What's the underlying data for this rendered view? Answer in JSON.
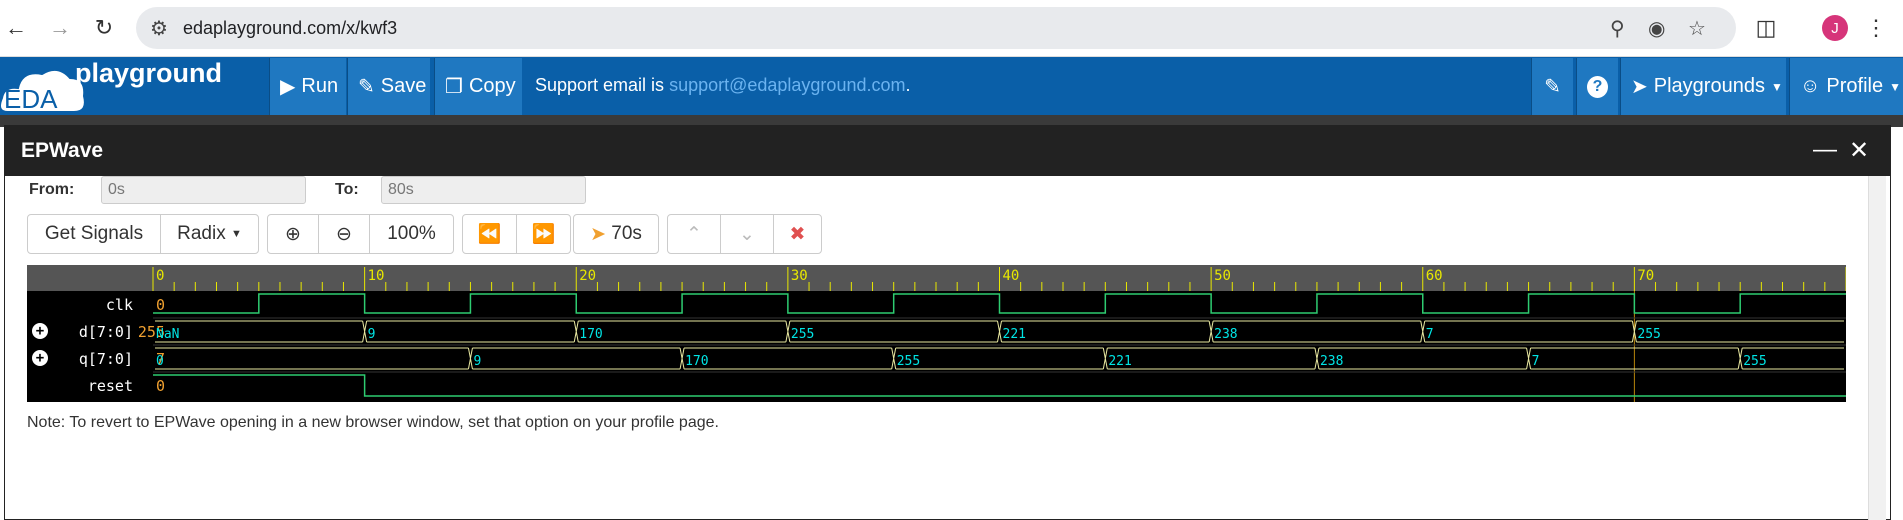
{
  "browser": {
    "url": "edaplayground.com/x/kwf3",
    "avatar_letter": "J"
  },
  "header": {
    "logo_text": "playground",
    "logo_cloud_text": "EDA",
    "run_label": "Run",
    "save_label": "Save",
    "copy_label": "Copy",
    "support_prefix": "Support email is ",
    "support_email": "support@edaplayground.com",
    "support_suffix": ".",
    "playgrounds_label": "Playgrounds",
    "profile_label": "Profile",
    "color": "#0a5fa8"
  },
  "epwave": {
    "title": "EPWave",
    "from_label": "From:",
    "from_value": "0s",
    "to_label": "To:",
    "to_value": "80s",
    "get_signals_label": "Get Signals",
    "radix_label": "Radix",
    "zoom_level": "100%",
    "cursor_time": "70s",
    "ruler_labels": [
      "0",
      "10",
      "20",
      "30",
      "40",
      "50",
      "60",
      "70"
    ],
    "signals": [
      {
        "name": "clk",
        "value": "0",
        "expandable": false,
        "type": "bit"
      },
      {
        "name": "d[7:0]",
        "value": "255",
        "expandable": true,
        "type": "bus",
        "segments": [
          {
            "t": 0,
            "v": "NaN"
          },
          {
            "t": 10,
            "v": "9"
          },
          {
            "t": 20,
            "v": "170"
          },
          {
            "t": 30,
            "v": "255"
          },
          {
            "t": 40,
            "v": "221"
          },
          {
            "t": 50,
            "v": "238"
          },
          {
            "t": 60,
            "v": "7"
          },
          {
            "t": 70,
            "v": "255"
          }
        ]
      },
      {
        "name": "q[7:0]",
        "value": "7",
        "expandable": true,
        "type": "bus",
        "segments": [
          {
            "t": 0,
            "v": "0"
          },
          {
            "t": 15,
            "v": "9"
          },
          {
            "t": 25,
            "v": "170"
          },
          {
            "t": 35,
            "v": "255"
          },
          {
            "t": 45,
            "v": "221"
          },
          {
            "t": 55,
            "v": "238"
          },
          {
            "t": 65,
            "v": "7"
          },
          {
            "t": 75,
            "v": "255"
          }
        ]
      },
      {
        "name": "reset",
        "value": "0",
        "expandable": false,
        "type": "bit"
      }
    ],
    "clk_period": 10,
    "reset_fall": 10,
    "time_end": 80,
    "cursor_at": 70,
    "note": "Note: To revert to EPWave opening in a new browser window, set that option on your profile page."
  }
}
